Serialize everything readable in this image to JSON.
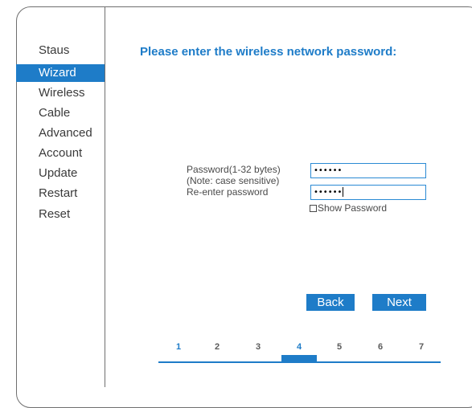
{
  "sidebar": {
    "items": [
      {
        "label": "Staus",
        "active": false
      },
      {
        "label": "Wizard",
        "active": true
      },
      {
        "label": "Wireless",
        "active": false
      },
      {
        "label": "Cable",
        "active": false
      },
      {
        "label": "Advanced",
        "active": false
      },
      {
        "label": "Account",
        "active": false
      },
      {
        "label": "Update",
        "active": false
      },
      {
        "label": "Restart",
        "active": false
      },
      {
        "label": "Reset",
        "active": false
      }
    ]
  },
  "main": {
    "heading": "Please enter the wireless network password:",
    "password_label": "Password(1-32 bytes)",
    "note_label": "(Note: case sensitive)",
    "reenter_label": "Re-enter password",
    "password_value": "••••••",
    "reenter_value": "••••••",
    "show_password_label": "Show Password",
    "show_password_checked": false,
    "back_label": "Back",
    "next_label": "Next"
  },
  "steps": {
    "items": [
      "1",
      "2",
      "3",
      "4",
      "5",
      "6",
      "7"
    ],
    "current": 4
  },
  "colors": {
    "accent": "#1e7cc8",
    "text": "#3a3a3a",
    "border": "#6f6f6f"
  }
}
